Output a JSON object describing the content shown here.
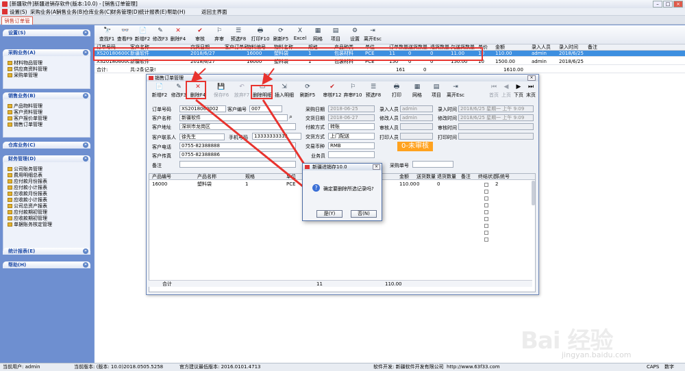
{
  "app": {
    "title": "[新疆软件]新疆进销存软件(版本:10.0) - [销售订单管理]",
    "menus": [
      "设置(S)",
      "采购业务(A)",
      "销售业务(B)",
      "仓库业务(C)",
      "财务管理(D)",
      "统计报表(E)",
      "帮助(H)",
      "返回主界面"
    ],
    "tab": "销售订单管理"
  },
  "sidebar": {
    "sections": [
      {
        "title": "设置(S)",
        "items": []
      },
      {
        "title": "采购业务(A)",
        "items": [
          "材料物品管理",
          "供应商资料管理",
          "采购单管理"
        ]
      },
      {
        "title": "销售业务(B)",
        "items": [
          "产品物料管理",
          "客户资料管理",
          "客户报价单管理",
          "销售订单管理"
        ]
      },
      {
        "title": "仓库业务(C)",
        "items": []
      },
      {
        "title": "财务管理(D)",
        "items": [
          "公司账务管理",
          "费用明细总表",
          "应付款月份报表",
          "应付款小计报表",
          "应收款月份报表",
          "应收款小计报表",
          "公司总资产报表",
          "应付款期初管理",
          "应收款期初管理",
          "单据账务核定管理"
        ]
      },
      {
        "title": "统计报表(E)",
        "items": []
      },
      {
        "title": "帮助(H)",
        "items": []
      }
    ]
  },
  "toolbar": [
    "查找F1",
    "查看F9",
    "新增F2",
    "修改F3",
    "删除F4",
    "审核",
    "弃审",
    "预选F8",
    "打印F10",
    "刷新F5",
    "Excel",
    "网格",
    "项目",
    "设置",
    "离开Esc"
  ],
  "grid": {
    "columns": [
      "订单号码",
      "客户名称",
      "交货日期",
      "客户订单号",
      "物料编号",
      "物料名称",
      "规格",
      "产品种类",
      "单位",
      "订单数量",
      "送货数量",
      "退货数量",
      "欠送货数量",
      "单价",
      "金额",
      "录入人员",
      "录入时间",
      "备注"
    ],
    "rows": [
      [
        "XS2018060002",
        "新疆软件",
        "2018/6/27",
        "",
        "16000",
        "塑料袋",
        "1",
        "包装材料",
        "PCE",
        "11",
        "0",
        "0",
        "11.00",
        "10",
        "110.00",
        "admin",
        "2018/6/25",
        ""
      ],
      [
        "XS2018060001",
        "新疆软件",
        "2018/6/27",
        "",
        "16000",
        "塑料袋",
        "1",
        "包装材料",
        "PCE",
        "150",
        "0",
        "0",
        "150.00",
        "10",
        "1500.00",
        "admin",
        "2018/6/25",
        ""
      ]
    ],
    "total_label": "合计:",
    "total_count": "共:2条记录!",
    "total_qty": "161",
    "total_sent": "0",
    "total_amount": "1610.00"
  },
  "dialog": {
    "title": "销售订单管理",
    "toolbar": [
      "新增F2",
      "修改F3",
      "删除F4",
      "保存F6",
      "放弃F7",
      "删除明细",
      "插入明细",
      "刷新F5",
      "审核F12",
      "弃审F10",
      "预选F8",
      "打印",
      "网格",
      "项目",
      "离开Esc"
    ],
    "nav": [
      "首页",
      "上页",
      "下页",
      "末页"
    ],
    "form": {
      "order_no_label": "订单号码",
      "order_no": "XS2018060002",
      "cust_no_label": "客户编号",
      "cust_no": "007",
      "cust_name_label": "客户名称",
      "cust_name": "新疆软件",
      "address_label": "客户地址",
      "address": "深圳市龙岗区",
      "contact_label": "客户联系人",
      "contact": "徐先生",
      "mobile_label": "手机号码",
      "mobile": "13333333333",
      "phone_label": "客户电话",
      "phone": "0755-82388888",
      "fax_label": "客户传真",
      "fax": "0755-82388886",
      "remark_label": "备注",
      "po_date_label": "采购日期",
      "po_date": "2018-06-25",
      "delivery_label": "交货日期",
      "delivery": "2018-06-27",
      "pay_label": "付款方式",
      "pay": "转账",
      "ship_label": "交货方式",
      "ship": "上门配送",
      "currency_label": "交易币种",
      "currency": "RMB",
      "sales_label": "业务员",
      "entry_user_label": "录入人员",
      "entry_user": "admin",
      "mod_user_label": "修改人员",
      "mod_user": "admin",
      "audit_user_label": "审核人员",
      "print_user_label": "打印人员",
      "entry_time_label": "录入时间",
      "entry_time": "2018/6/25 星期一 上午 9:09",
      "mod_time_label": "修改时间",
      "mod_time": "2018/6/25 星期一 上午 9:09",
      "audit_time_label": "审核时间",
      "print_time_label": "打印时间",
      "po_no_label": "采购单号",
      "status": "0-未审核"
    },
    "detail": {
      "columns": [
        "产品编号",
        "产品名称",
        "规格",
        "单位",
        "金额",
        "送货数量",
        "退货数量",
        "备注",
        "终结状态",
        "系统号"
      ],
      "row": [
        "16000",
        "塑料袋",
        "1",
        "PCE",
        "110.00",
        "0",
        "0",
        "",
        "",
        "2"
      ],
      "total_label": "合计",
      "total_qty": "11",
      "total_amount": "110.00"
    }
  },
  "msgbox": {
    "title": "新疆进销存10.0",
    "text": "确定要删除所选记录吗?",
    "yes": "是(Y)",
    "no": "否(N)"
  },
  "status_bar": {
    "user": "当前用户: admin",
    "version": "当前版本: (版本: 10.0)2018.0505.5258",
    "lowest": "官方建议最低版本: 2016.0101.4713",
    "dev": "软件开发: 新疆软件开发有限公司",
    "url": "http://www.63f33.com",
    "caps": "CAPS",
    "num": "数字"
  },
  "watermark": {
    "logo": "Bai 经验",
    "url": "jingyan.baidu.com"
  }
}
